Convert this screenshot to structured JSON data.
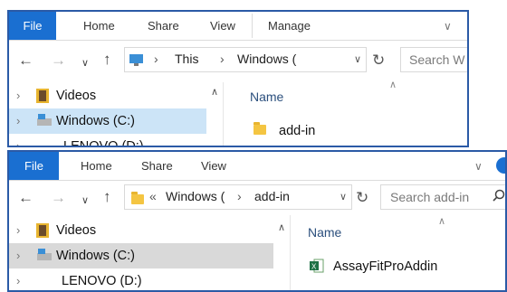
{
  "window1": {
    "ribbon": {
      "tabs": [
        "File",
        "Home",
        "Share",
        "View",
        "Manage"
      ]
    },
    "address": {
      "path": [
        "This",
        "Windows ("
      ]
    },
    "search": {
      "placeholder": "Search W"
    },
    "nav_pane": [
      "Videos",
      "Windows (C:)",
      "LENOVO (D:)"
    ],
    "content": {
      "column_header": "Name",
      "files": [
        "add-in"
      ]
    }
  },
  "window2": {
    "ribbon": {
      "tabs": [
        "File",
        "Home",
        "Share",
        "View"
      ]
    },
    "address": {
      "overflow": "«",
      "path": [
        "Windows (",
        "add-in"
      ]
    },
    "search": {
      "placeholder": "Search add-in"
    },
    "nav_pane": [
      "Videos",
      "Windows (C:)",
      "LENOVO (D:)"
    ],
    "content": {
      "column_header": "Name",
      "files": [
        "AssayFitProAddin"
      ]
    }
  },
  "colors": {
    "accent": "#1a6fd1",
    "border": "#2b5aa6",
    "selection": "#cce4f7",
    "selection_inactive": "#d9d9d9"
  },
  "icons": [
    "back-arrow-icon",
    "forward-arrow-icon",
    "recent-locations-icon",
    "up-arrow-icon",
    "this-pc-icon",
    "refresh-icon",
    "search-icon",
    "folder-icon",
    "video-library-icon",
    "drive-icon",
    "excel-file-icon"
  ]
}
